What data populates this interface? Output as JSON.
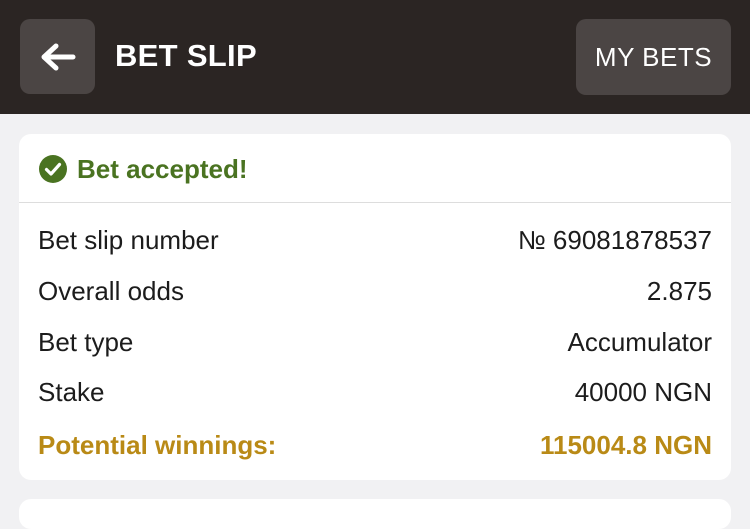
{
  "header": {
    "title": "BET SLIP",
    "my_bets_label": "MY BETS",
    "back_icon": "arrow-left-icon"
  },
  "status": {
    "text": "Bet accepted!",
    "icon": "check-circle-icon",
    "color": "#4a7321"
  },
  "details": [
    {
      "label": "Bet slip number",
      "value": "№ 69081878537"
    },
    {
      "label": "Overall odds",
      "value": "2.875"
    },
    {
      "label": "Bet type",
      "value": "Accumulator"
    },
    {
      "label": "Stake",
      "value": "40000 NGN"
    },
    {
      "label": "Potential winnings:",
      "value": "115004.8 NGN"
    }
  ],
  "colors": {
    "header_bg": "#2b2523",
    "button_bg": "#4b4544",
    "highlight": "#b98a16"
  }
}
